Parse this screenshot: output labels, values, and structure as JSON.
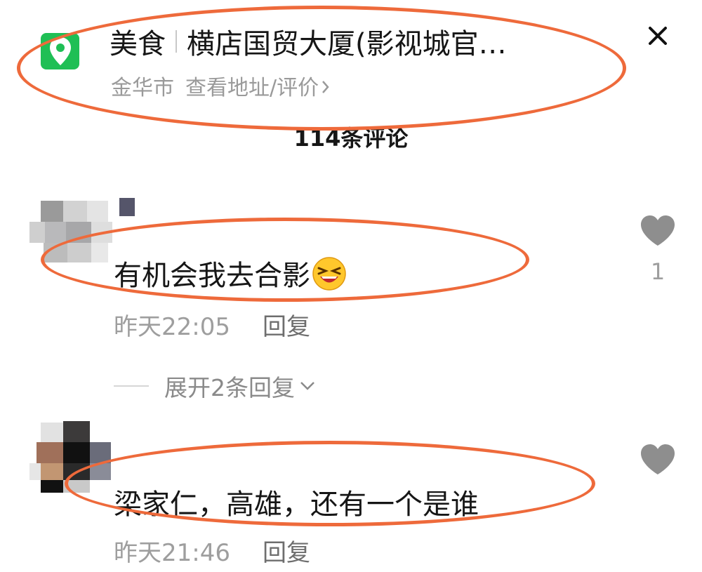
{
  "location": {
    "category": "美食",
    "name": "横店国贸大厦(影视城官…",
    "city": "金华市",
    "link_label": "查看地址/评价"
  },
  "comments_count": "114条评论",
  "comments": [
    {
      "text": "有机会我去合影",
      "time": "昨天22:05",
      "reply_label": "回复",
      "likes": "1",
      "expand_label": "展开2条回复"
    },
    {
      "text": "梁家仁，高雄，还有一个是谁",
      "time": "昨天21:46",
      "reply_label": "回复"
    }
  ],
  "colors": {
    "accent_green": "#1fbf55",
    "highlight": "#ee6a3b",
    "secondary_text": "#9e9e9e"
  },
  "icons": [
    "location-pin-icon",
    "close-icon",
    "heart-icon",
    "chevron-right-icon",
    "chevron-down-icon",
    "laughing-emoji-icon"
  ]
}
